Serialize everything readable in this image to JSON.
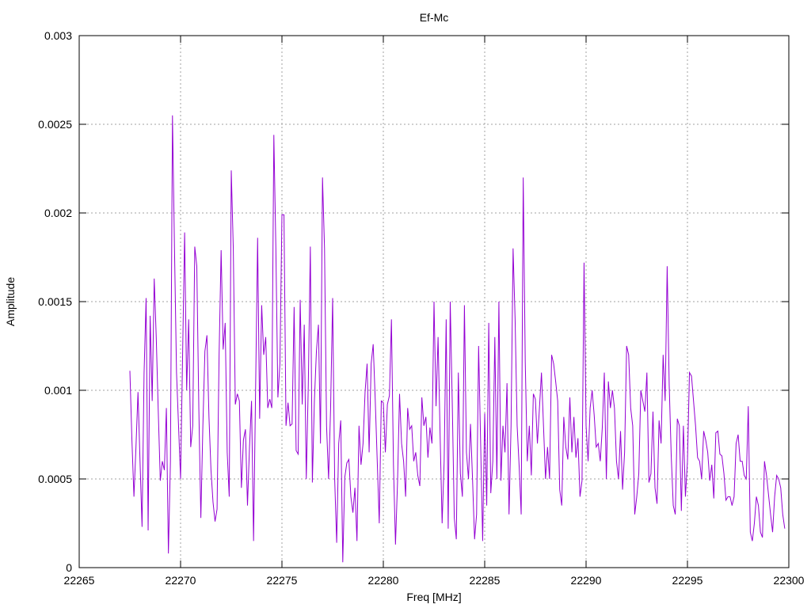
{
  "chart_data": {
    "type": "line",
    "title": "Ef-Mc",
    "xlabel": "Freq [MHz]",
    "ylabel": "Amplitude",
    "xlim": [
      22265,
      22300
    ],
    "ylim": [
      0,
      0.003
    ],
    "x_ticks": [
      "22265",
      "22270",
      "22275",
      "22280",
      "22285",
      "22290",
      "22295",
      "22300"
    ],
    "x_tick_values": [
      22265,
      22270,
      22275,
      22280,
      22285,
      22290,
      22295,
      22300
    ],
    "y_ticks": [
      "0",
      "0.0005",
      "0.001",
      "0.0015",
      "0.002",
      "0.0025",
      "0.003"
    ],
    "y_tick_values": [
      0,
      0.0005,
      0.001,
      0.0015,
      0.002,
      0.0025,
      0.003
    ],
    "grid": true,
    "series": [
      {
        "color": "#9400d3",
        "x_start": 22267.5,
        "x_step": 0.1,
        "values": [
          0.00111,
          0.00072,
          0.0004,
          0.00068,
          0.00099,
          0.0006,
          0.00023,
          0.0011,
          0.00152,
          0.00021,
          0.00142,
          0.00094,
          0.00163,
          0.0013,
          0.00088,
          0.00049,
          0.0006,
          0.00055,
          0.0009,
          8e-05,
          0.0006,
          0.00255,
          0.0018,
          0.0011,
          0.0008,
          0.0005,
          0.0012,
          0.00189,
          0.001,
          0.0014,
          0.00068,
          0.0008,
          0.00181,
          0.0017,
          0.0009,
          0.00028,
          0.0008,
          0.00122,
          0.00131,
          0.00085,
          0.00055,
          0.00037,
          0.00026,
          0.00033,
          0.0012,
          0.00179,
          0.00123,
          0.00138,
          0.00065,
          0.0004,
          0.00224,
          0.0018,
          0.00092,
          0.00098,
          0.00094,
          0.00045,
          0.00072,
          0.00078,
          0.00035,
          0.00068,
          0.00094,
          0.00015,
          0.001,
          0.00186,
          0.00084,
          0.00148,
          0.0012,
          0.0013,
          0.0009,
          0.00095,
          0.0009,
          0.00244,
          0.0018,
          0.00096,
          0.00115,
          0.00199,
          0.00199,
          0.0008,
          0.00093,
          0.0008,
          0.00081,
          0.00147,
          0.00066,
          0.00064,
          0.00151,
          0.00092,
          0.00137,
          0.0005,
          0.00103,
          0.00181,
          0.00048,
          0.00094,
          0.00122,
          0.00137,
          0.0007,
          0.0022,
          0.0018,
          0.0008,
          0.0005,
          0.0009,
          0.00152,
          0.0005,
          0.00014,
          0.0007,
          0.00083,
          3e-05,
          0.00051,
          0.00059,
          0.00061,
          0.0004,
          0.00031,
          0.00045,
          0.00015,
          0.0008,
          0.00058,
          0.0007,
          0.00099,
          0.00115,
          0.00065,
          0.00115,
          0.00126,
          0.00095,
          0.0006,
          0.00025,
          0.00094,
          0.00093,
          0.00065,
          0.00092,
          0.00097,
          0.0014,
          0.00058,
          0.00013,
          0.00048,
          0.00098,
          0.0007,
          0.0006,
          0.0004,
          0.0009,
          0.00078,
          0.0008,
          0.0006,
          0.00065,
          0.00052,
          0.00046,
          0.00096,
          0.0008,
          0.00085,
          0.00062,
          0.00079,
          0.0007,
          0.0015,
          0.00091,
          0.0013,
          0.00075,
          0.00025,
          0.0006,
          0.0014,
          0.00022,
          0.0015,
          0.00093,
          0.00028,
          0.00016,
          0.0011,
          0.00053,
          0.0004,
          0.00148,
          0.00065,
          0.0005,
          0.00081,
          0.0005,
          0.00016,
          0.0003,
          0.00125,
          0.0007,
          0.00015,
          0.00087,
          0.00035,
          0.00138,
          0.00042,
          0.0006,
          0.0013,
          0.0005,
          0.0015,
          0.00049,
          0.0008,
          0.00065,
          0.00104,
          0.0003,
          0.0008,
          0.0018,
          0.0014,
          0.0008,
          0.00057,
          0.0003,
          0.0022,
          0.00116,
          0.0006,
          0.0008,
          0.00052,
          0.00098,
          0.00095,
          0.0007,
          0.0009,
          0.0011,
          0.0008,
          0.0005,
          0.00068,
          0.0005,
          0.0012,
          0.00115,
          0.00105,
          0.00094,
          0.00044,
          0.00035,
          0.00085,
          0.00068,
          0.00061,
          0.00096,
          0.00065,
          0.00085,
          0.00062,
          0.00073,
          0.0004,
          0.00049,
          0.00172,
          0.0008,
          0.0006,
          0.0009,
          0.001,
          0.00086,
          0.00068,
          0.0007,
          0.0006,
          0.00079,
          0.0011,
          0.0005,
          0.00105,
          0.0009,
          0.001,
          0.0009,
          0.0006,
          0.0005,
          0.00077,
          0.00044,
          0.00065,
          0.00125,
          0.0012,
          0.0009,
          0.0008,
          0.0003,
          0.0004,
          0.00053,
          0.001,
          0.00094,
          0.00088,
          0.0011,
          0.00048,
          0.00053,
          0.00088,
          0.00045,
          0.00036,
          0.00083,
          0.0007,
          0.0012,
          0.00094,
          0.0017,
          0.00103,
          0.00063,
          0.00035,
          0.0003,
          0.00084,
          0.0008,
          0.00032,
          0.0008,
          0.0004,
          0.0006,
          0.0011,
          0.00108,
          0.00094,
          0.0008,
          0.00062,
          0.0006,
          0.0005,
          0.00077,
          0.00072,
          0.00065,
          0.00049,
          0.00058,
          0.00039,
          0.00076,
          0.00077,
          0.00064,
          0.00063,
          0.00053,
          0.00038,
          0.0004,
          0.0004,
          0.00035,
          0.0004,
          0.0007,
          0.00075,
          0.0006,
          0.0006,
          0.00052,
          0.0005,
          0.00091,
          0.0002,
          0.00015,
          0.00025,
          0.0004,
          0.00035,
          0.0002,
          0.00017,
          0.0006,
          0.00052,
          0.00041,
          0.0003,
          0.0002,
          0.0004,
          0.00052,
          0.0005,
          0.00045,
          0.0003,
          0.00022
        ]
      }
    ]
  }
}
